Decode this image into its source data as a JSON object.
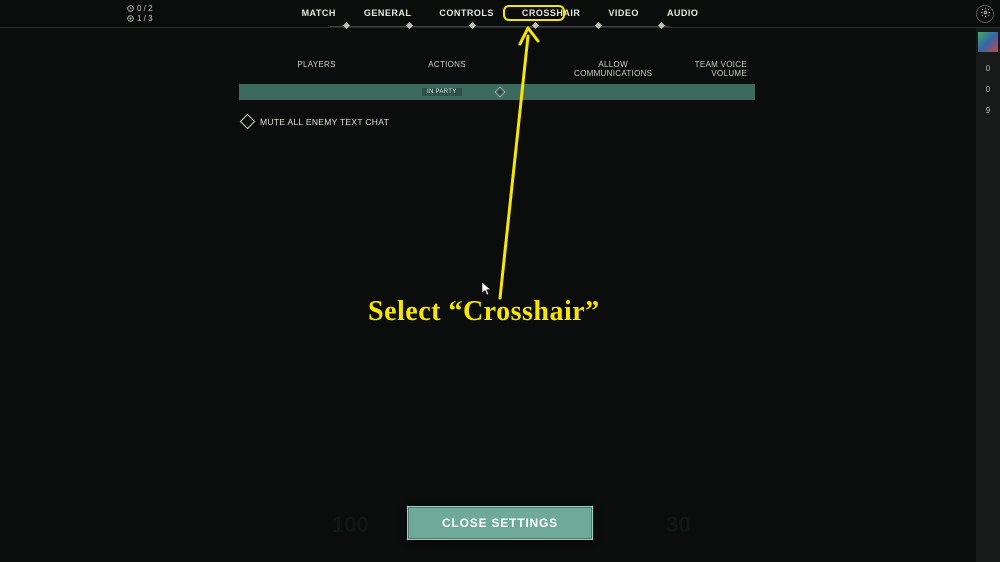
{
  "score": {
    "top": "0 / 2",
    "bottom": "1 / 3"
  },
  "nav": {
    "items": [
      "MATCH",
      "GENERAL",
      "CONTROLS",
      "CROSSHAIR",
      "VIDEO",
      "AUDIO"
    ],
    "highlighted_index": 3
  },
  "columns": {
    "players": "PLAYERS",
    "actions": "ACTIONS",
    "allow_comm": "ALLOW COMMUNICATIONS",
    "team_volume": "TEAM VOICE VOLUME"
  },
  "player_row": {
    "badge": "IN PARTY"
  },
  "mute_toggle": {
    "label": "MUTE ALL ENEMY TEXT CHAT"
  },
  "sidebar": {
    "values": [
      "0",
      "0",
      "9"
    ]
  },
  "annotation": {
    "text": "Select “Crosshair”"
  },
  "close_button": "CLOSE SETTINGS",
  "bg_numbers": {
    "left": "100",
    "right": "30"
  }
}
